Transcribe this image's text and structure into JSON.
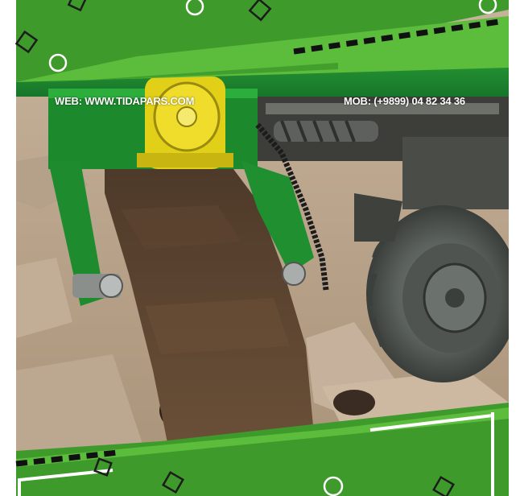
{
  "overlay": {
    "web": "WEB: WWW.TIDAPARS.COM",
    "mob": "MOB: (+9899) 04 82 34 36"
  },
  "colors": {
    "frame_green": "#3f9a2c",
    "frame_light_green": "#5bbd3b",
    "machine_green": "#1f8a2a",
    "motor_yellow": "#e6d21c",
    "soil_brown": "#5a4432",
    "sand": "#b8a48c",
    "tire_gray": "#5e6460"
  },
  "icons": {
    "frame_decorations": [
      "outline-diamond-icon",
      "outline-circle-icon",
      "dashed-line-icon"
    ]
  }
}
